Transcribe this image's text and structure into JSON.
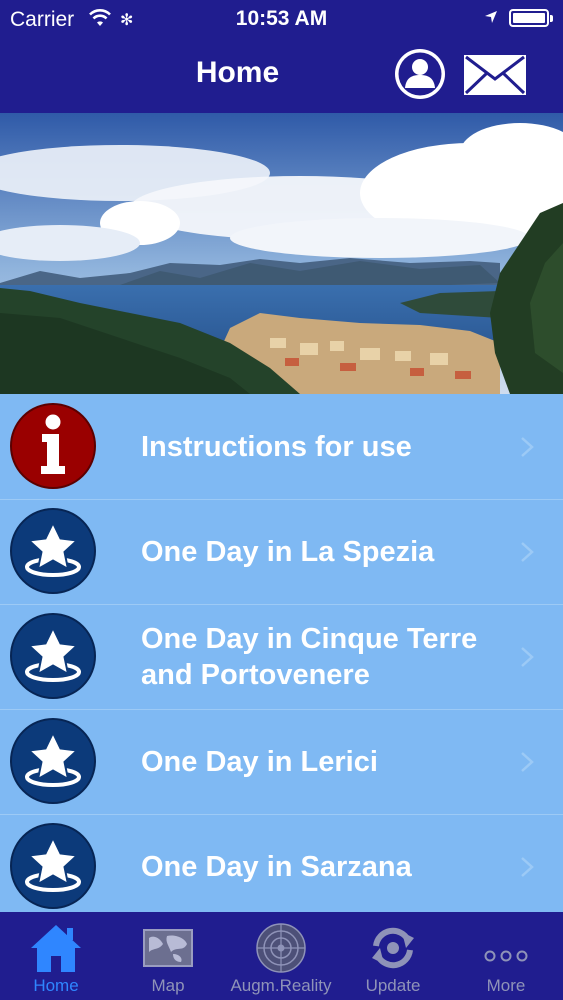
{
  "status": {
    "carrier": "Carrier",
    "time": "10:53 AM"
  },
  "header": {
    "title": "Home"
  },
  "hero": {
    "image": "coastal-bay-landscape"
  },
  "list": [
    {
      "label": "Instructions for use",
      "icon": "info-icon",
      "badge_color": "#a00000"
    },
    {
      "label": "One Day in La Spezia",
      "icon": "star-icon",
      "badge_color": "#0c3a7a"
    },
    {
      "label": "One Day in Cinque Terre and Portovenere",
      "icon": "star-icon",
      "badge_color": "#0c3a7a"
    },
    {
      "label": "One Day in Lerici",
      "icon": "star-icon",
      "badge_color": "#0c3a7a"
    },
    {
      "label": "One Day in Sarzana",
      "icon": "star-icon",
      "badge_color": "#0c3a7a"
    }
  ],
  "tabs": [
    {
      "label": "Home",
      "icon": "home-icon",
      "active": true
    },
    {
      "label": "Map",
      "icon": "map-icon",
      "active": false
    },
    {
      "label": "Augm.Reality",
      "icon": "radar-icon",
      "active": false
    },
    {
      "label": "Update",
      "icon": "refresh-icon",
      "active": false
    },
    {
      "label": "More",
      "icon": "more-icon",
      "active": false
    }
  ],
  "colors": {
    "bar": "#201d8f",
    "list_bg": "#7fb9f3",
    "active_tab": "#2f86ff",
    "inactive_tab": "#8f93b8"
  }
}
